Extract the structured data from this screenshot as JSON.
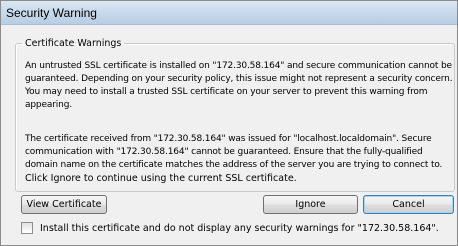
{
  "window": {
    "title": "Security Warning"
  },
  "group": {
    "legend": "Certificate Warnings",
    "paragraph1_lines": [
      "An untrusted SSL certificate is installed on \"172.30.58.164\" and secure communication cannot be",
      "guaranteed.  Depending on your security policy, this issue might not represent a security concern.",
      " You may need to install a trusted SSL certificate on your server to prevent this warning from",
      "appearing."
    ],
    "paragraph2_lines": [
      "The certificate received from \"172.30.58.164\" was issued for \"localhost.localdomain\".  Secure",
      "communication with \"172.30.58.164\" cannot be guaranteed.  Ensure that the fully-qualified",
      "domain name on the certificate matches the address of the server you are trying to connect to."
    ]
  },
  "ignore_info": "Click Ignore to continue using the current SSL certificate.",
  "buttons": {
    "view_certificate": "View Certificate",
    "ignore": "Ignore",
    "cancel": "Cancel"
  },
  "checkbox": {
    "label": "Install this certificate and do not display any security warnings for \"172.30.58.164\".",
    "checked": false
  }
}
